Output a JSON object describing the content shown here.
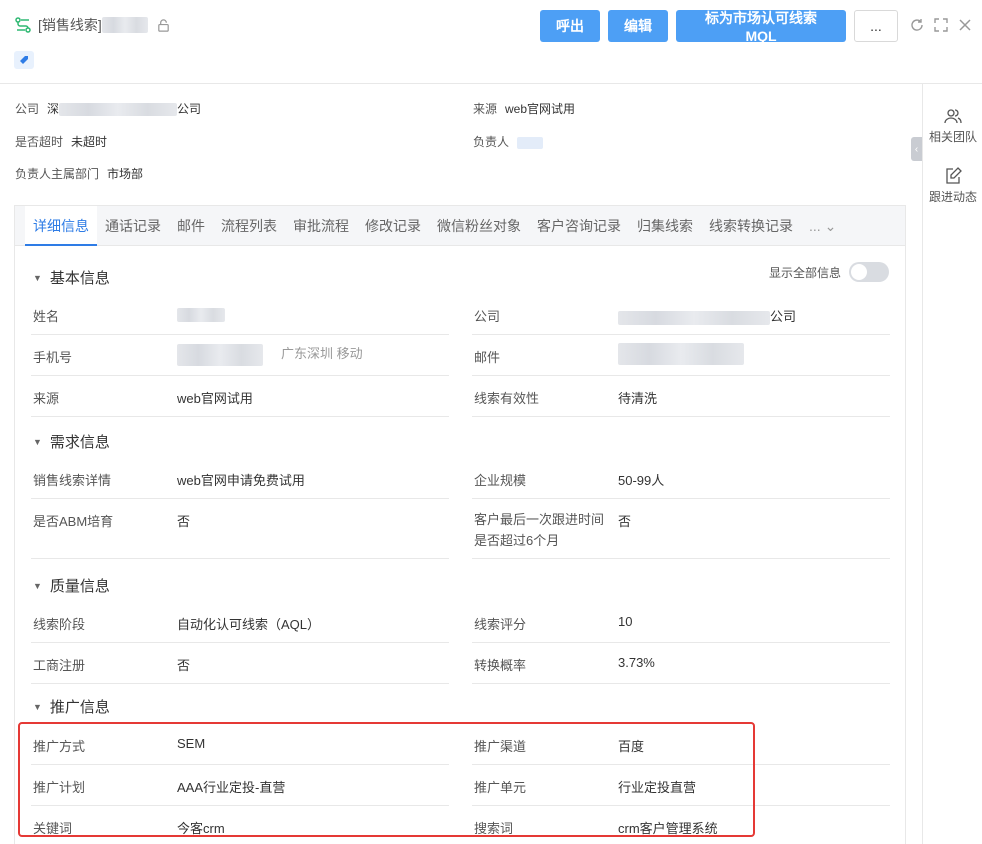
{
  "header": {
    "title_prefix": "[销售线索]",
    "buttons": {
      "call": "呼出",
      "edit": "编辑",
      "mark_mql": "标为市场认可线索MQL",
      "more": "..."
    }
  },
  "summary": {
    "company": {
      "label": "公司",
      "value_prefix": "深",
      "value_suffix": "公司"
    },
    "source": {
      "label": "来源",
      "value": "web官网试用"
    },
    "overdue": {
      "label": "是否超时",
      "value": "未超时"
    },
    "owner": {
      "label": "负责人"
    },
    "department": {
      "label": "负责人主属部门",
      "value": "市场部"
    }
  },
  "rail": {
    "team": "相关团队",
    "follow": "跟进动态"
  },
  "tabs": [
    "详细信息",
    "通话记录",
    "邮件",
    "流程列表",
    "审批流程",
    "修改记录",
    "微信粉丝对象",
    "客户咨询记录",
    "归集线索",
    "线索转换记录"
  ],
  "tabs_more": "...",
  "show_all": "显示全部信息",
  "sections": {
    "basic": {
      "title": "基本信息",
      "name_label": "姓名",
      "company_label": "公司",
      "company_suffix": "公司",
      "phone_label": "手机号",
      "phone_location": "广东深圳 移动",
      "email_label": "邮件",
      "source_label": "来源",
      "source_value": "web官网试用",
      "validity_label": "线索有效性",
      "validity_value": "待清洗"
    },
    "demand": {
      "title": "需求信息",
      "detail_label": "销售线索详情",
      "detail_value": "web官网申请免费试用",
      "scale_label": "企业规模",
      "scale_value": "50-99人",
      "abm_label": "是否ABM培育",
      "abm_value": "否",
      "last_follow_label": "客户最后一次跟进时间是否超过6个月",
      "last_follow_value": "否"
    },
    "quality": {
      "title": "质量信息",
      "stage_label": "线索阶段",
      "stage_value": "自动化认可线索（AQL）",
      "score_label": "线索评分",
      "score_value": "10",
      "reg_label": "工商注册",
      "reg_value": "否",
      "conv_label": "转换概率",
      "conv_value": "3.73%"
    },
    "promo": {
      "title": "推广信息",
      "method_label": "推广方式",
      "method_value": "SEM",
      "channel_label": "推广渠道",
      "channel_value": "百度",
      "plan_label": "推广计划",
      "plan_value": "AAA行业定投-直营",
      "unit_label": "推广单元",
      "unit_value": "行业定投直营",
      "keyword_label": "关键词",
      "keyword_value": "今客crm",
      "search_label": "搜索词",
      "search_value": "crm客户管理系统"
    }
  },
  "colors": {
    "primary": "#4d9ff5",
    "tab_active": "#2e7ce6",
    "link": "#2e8ae6",
    "highlight": "#e53935"
  }
}
